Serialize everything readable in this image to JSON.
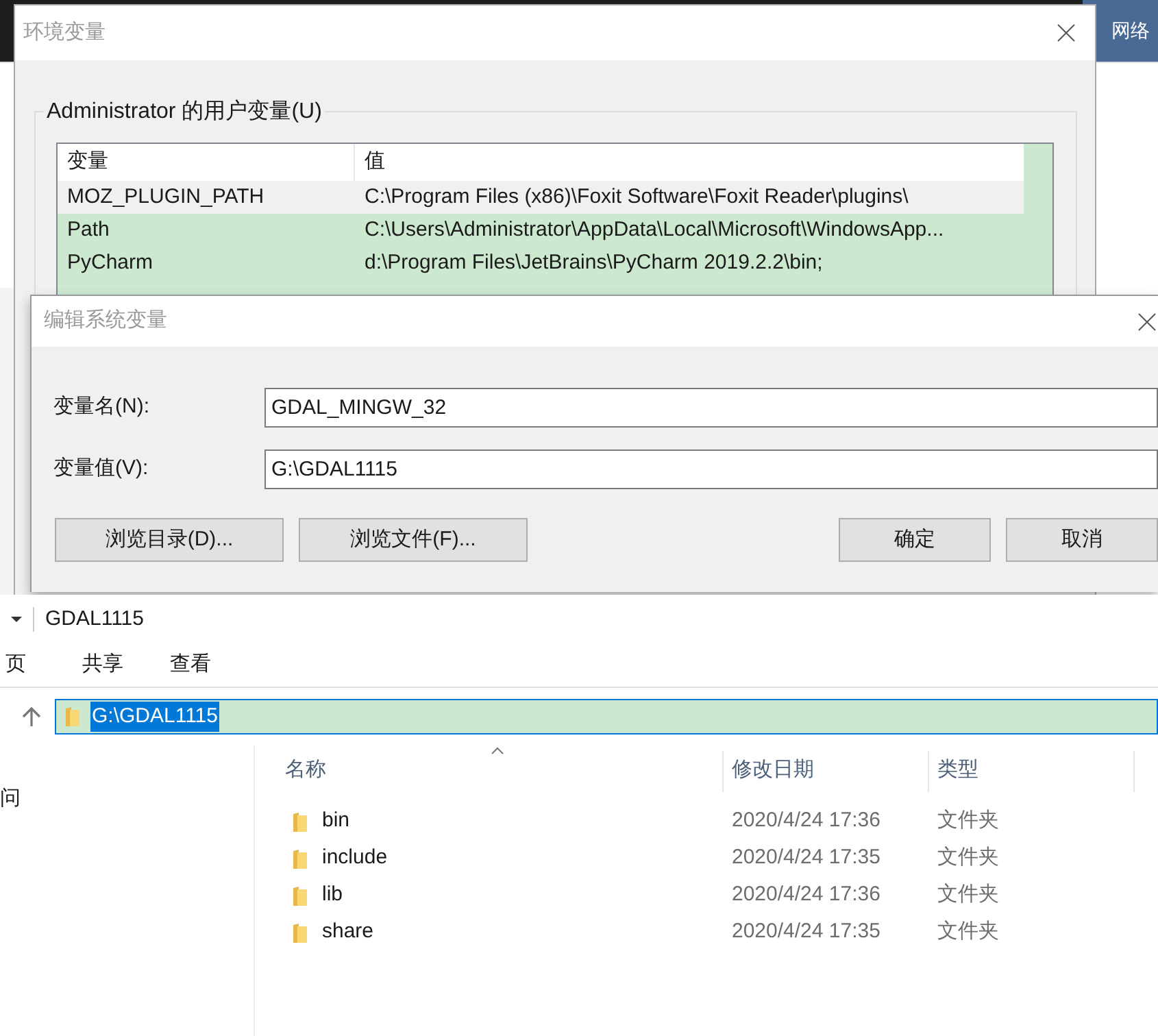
{
  "desktop": {
    "icon_label": "网络"
  },
  "env_window": {
    "title": "环境变量",
    "group_label": "Administrator 的用户变量(U)",
    "columns": [
      "变量",
      "值"
    ],
    "rows": [
      {
        "name": "MOZ_PLUGIN_PATH",
        "value": "C:\\Program Files (x86)\\Foxit Software\\Foxit Reader\\plugins\\",
        "selected": true
      },
      {
        "name": "Path",
        "value": "C:\\Users\\Administrator\\AppData\\Local\\Microsoft\\WindowsApp...",
        "selected": false
      },
      {
        "name": "PyCharm",
        "value": "d:\\Program Files\\JetBrains\\PyCharm 2019.2.2\\bin;",
        "selected": false
      }
    ]
  },
  "edit_dialog": {
    "title": "编辑系统变量",
    "fields": [
      {
        "label": "变量名(N):",
        "value": "GDAL_MINGW_32"
      },
      {
        "label": "变量值(V):",
        "value": "G:\\GDAL1115"
      }
    ],
    "left_buttons": [
      "浏览目录(D)...",
      "浏览文件(F)..."
    ],
    "right_buttons": [
      "确定",
      "取消"
    ]
  },
  "explorer": {
    "title": "GDAL1115",
    "ribbon_tabs": [
      "页",
      "共享",
      "查看"
    ],
    "address": {
      "value": "G:\\GDAL1115",
      "selected": true
    },
    "nav_items": [
      "问"
    ],
    "columns": [
      "名称",
      "修改日期",
      "类型"
    ],
    "files": [
      {
        "name": "bin",
        "modified": "2020/4/24 17:36",
        "type": "文件夹"
      },
      {
        "name": "include",
        "modified": "2020/4/24 17:35",
        "type": "文件夹"
      },
      {
        "name": "lib",
        "modified": "2020/4/24 17:36",
        "type": "文件夹"
      },
      {
        "name": "share",
        "modified": "2020/4/24 17:35",
        "type": "文件夹"
      }
    ]
  }
}
